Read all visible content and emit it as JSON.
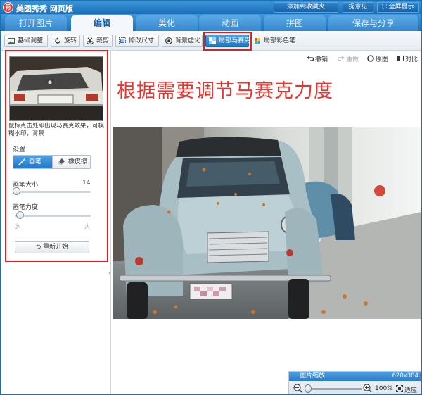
{
  "app": {
    "logo_glyph": "秀",
    "title": "美图秀秀 网页版",
    "favorite_label": "添加到收藏夹",
    "feedback_label": "提意见",
    "fullscreen_label": "全屏显示"
  },
  "tabs": [
    {
      "label": "打开图片",
      "active": false
    },
    {
      "label": "编辑",
      "active": true
    },
    {
      "label": "美化",
      "active": false
    },
    {
      "label": "动画",
      "active": false
    },
    {
      "label": "拼图",
      "active": false
    },
    {
      "label": "保存与分享",
      "active": false
    }
  ],
  "toolbar": {
    "basic": "基础调整",
    "rotate": "旋转",
    "crop": "裁剪",
    "resize": "修改尺寸",
    "blur": "背景虚化",
    "mosaic": "局部马赛克",
    "colorpen": "局部彩色笔"
  },
  "panel": {
    "hint": "鼠标点击处即出现马赛克效果，可模糊水印，背景",
    "settings_label": "设置",
    "brush_label": "画笔",
    "eraser_label": "橡皮擦",
    "brush_size_label": "画笔大小:",
    "brush_size_value": "14",
    "brush_force_label": "画笔力度:",
    "force_min_label": "小",
    "force_max_label": "大",
    "restart_label": "重新开始"
  },
  "canvas_controls": {
    "undo": "撤销",
    "redo": "重做",
    "original": "原图",
    "compare": "对比"
  },
  "annotation": "根据需要调节马赛克力度",
  "zoom": {
    "title": "图片缩放",
    "image_size": "620x384",
    "percent": "100%",
    "fit_label": "适应"
  },
  "colors": {
    "brand_blue": "#1f6fb8",
    "highlight_red": "#e02020",
    "annotation_red": "#e8352e"
  }
}
